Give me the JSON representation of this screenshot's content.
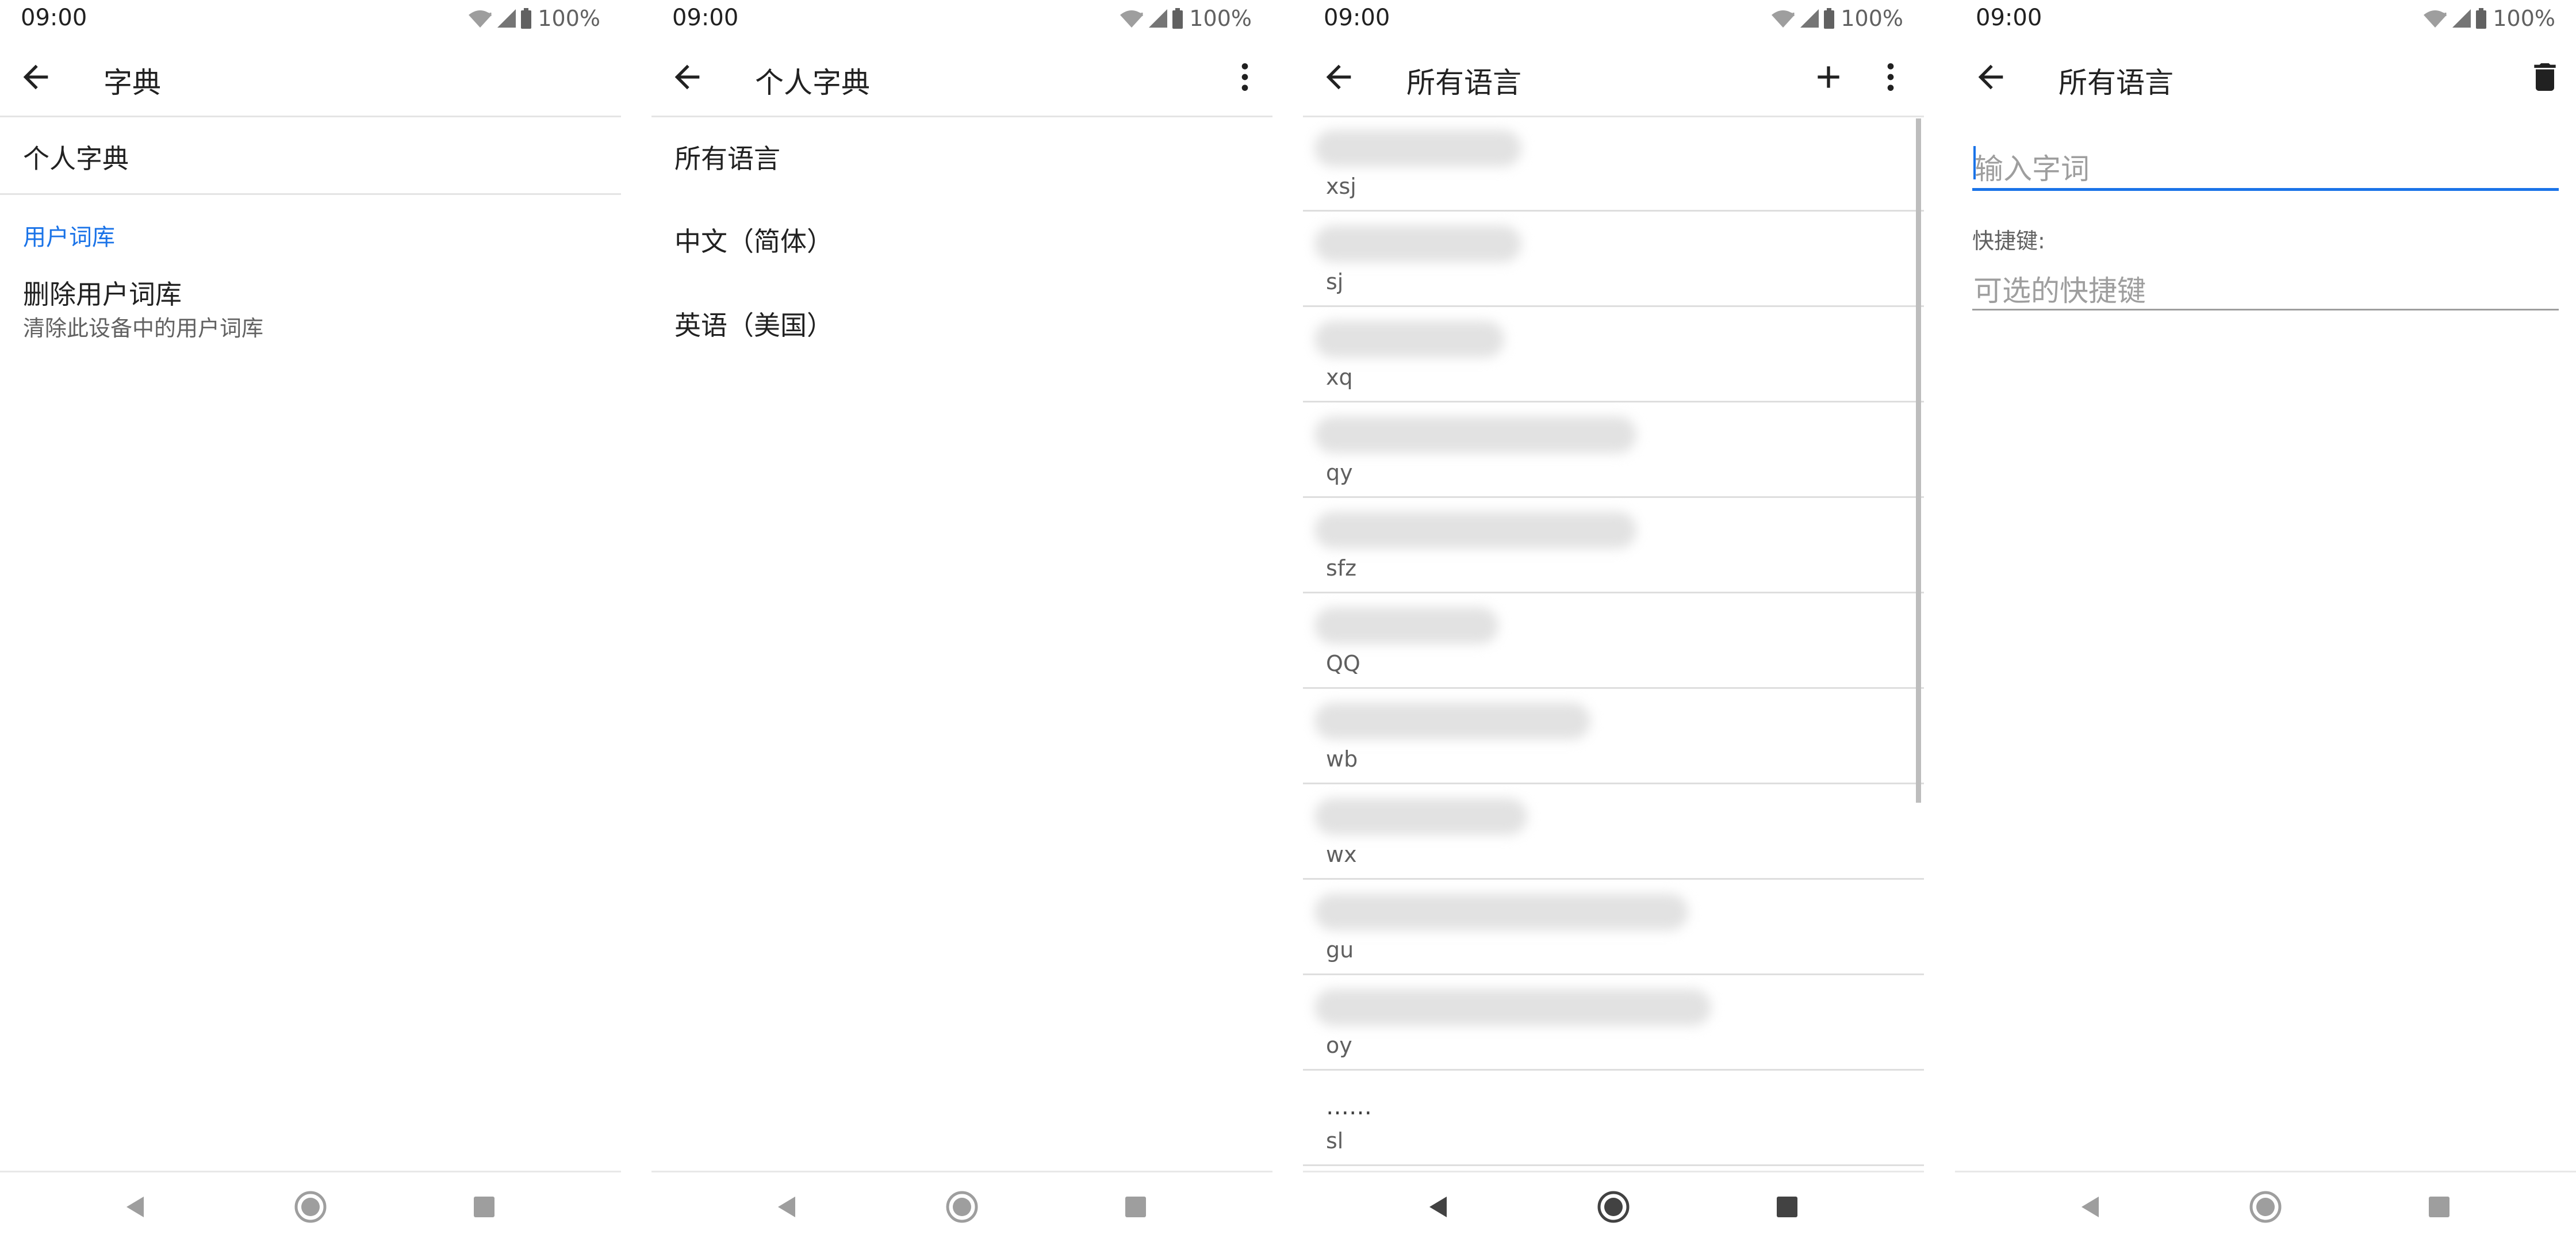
{
  "status": {
    "time": "09:00",
    "battery": "100%"
  },
  "screen1": {
    "title": "字典",
    "personal_dict": "个人字典",
    "category": "用户词库",
    "delete_title": "删除用户词库",
    "delete_summary": "清除此设备中的用户词库"
  },
  "screen2": {
    "title": "个人字典",
    "languages": [
      "所有语言",
      "中文（简体）",
      "英语（美国）"
    ]
  },
  "screen3": {
    "title": "所有语言",
    "shortcuts": [
      "xsj",
      "sj",
      "xq",
      "qy",
      "sfz",
      "QQ",
      "wb",
      "wx",
      "gu",
      "oy",
      "sl"
    ],
    "ellipsis": "……"
  },
  "screen4": {
    "title": "所有语言",
    "word_placeholder": "输入字词",
    "shortcut_label": "快捷键:",
    "shortcut_placeholder": "可选的快捷键"
  },
  "icons": {
    "back": "back-arrow-icon",
    "more": "more-vert-icon",
    "add": "add-icon",
    "delete": "delete-icon",
    "wifi": "wifi-icon",
    "signal": "signal-icon",
    "battery": "battery-icon",
    "nav_back": "nav-back-icon",
    "nav_home": "nav-home-icon",
    "nav_recents": "nav-recents-icon"
  },
  "colors": {
    "accent": "#1a73e8",
    "text": "#212121",
    "secondary": "#616161",
    "divider": "#e4e4e4"
  }
}
